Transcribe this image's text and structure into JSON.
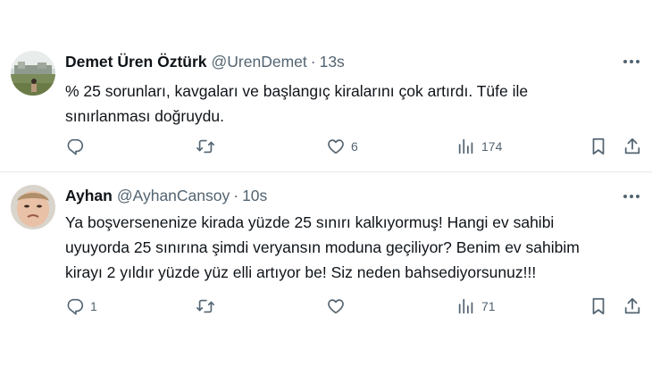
{
  "tweets": [
    {
      "name": "Demet Üren Öztürk",
      "handle": "@UrenDemet",
      "separator": "·",
      "time": "13s",
      "lines": [
        "% 25 sorunları, kavgaları ve başlangıç kiralarını çok artırdı. Tüfe ile",
        "sınırlanması doğruydu."
      ],
      "reply_count": "",
      "retweet_count": "",
      "like_count": "6",
      "view_count": "174"
    },
    {
      "name": "Ayhan",
      "handle": "@AyhanCansoy",
      "separator": "·",
      "time": "10s",
      "lines": [
        "Ya boşversenenize kirada yüzde 25 sınırı kalkıyormuş! Hangi ev sahibi",
        "uyuyorda 25 sınırına şimdi veryansın moduna geçiliyor? Benim ev sahibim",
        "kirayı 2 yıldır yüzde yüz elli artıyor be! Siz neden bahsediyorsunuz!!!"
      ],
      "reply_count": "1",
      "retweet_count": "",
      "like_count": "",
      "view_count": "71"
    }
  ],
  "colors": {
    "text": "#0f1419",
    "secondary": "#536471",
    "divider": "#e5e9ec"
  },
  "icons": [
    "more-icon",
    "reply-icon",
    "retweet-icon",
    "like-icon",
    "views-icon",
    "bookmark-icon",
    "share-icon"
  ]
}
